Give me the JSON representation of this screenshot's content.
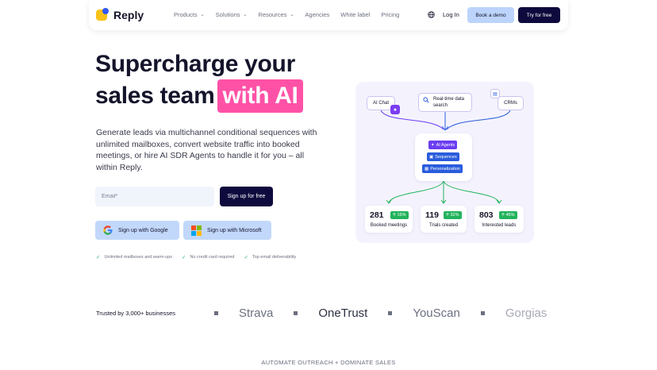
{
  "nav": {
    "brand": "Reply",
    "links": [
      {
        "label": "Products",
        "dropdown": true
      },
      {
        "label": "Solutions",
        "dropdown": true
      },
      {
        "label": "Resources",
        "dropdown": true
      },
      {
        "label": "Agencies",
        "dropdown": false
      },
      {
        "label": "White label",
        "dropdown": false
      },
      {
        "label": "Pricing",
        "dropdown": false
      }
    ],
    "login": "Log In",
    "book_demo": "Book a demo",
    "try_free": "Try for free",
    "language_icon": "globe-icon"
  },
  "hero": {
    "title_line1": "Supercharge your",
    "title_line2": "sales team",
    "title_highlight": "with AI",
    "subtitle": "Generate leads via multichannel conditional sequences with unlimited mailboxes, convert website traffic into booked meetings, or hire AI SDR Agents to handle it for you – all within Reply.",
    "email_placeholder": "Email*",
    "signup_button": "Sign up for free",
    "google_button": "Sign up with Google",
    "microsoft_button": "Sign up with Microsoft",
    "checks": [
      "Unlimited mailboxes and warm-ups",
      "No credit card required",
      "Top email deliverability"
    ]
  },
  "illustration": {
    "sources": [
      "AI Chat",
      "Real-time data search",
      "CRMs"
    ],
    "tags": [
      "AI Agents",
      "Sequences",
      "Personalization"
    ],
    "stats": [
      {
        "value": "281",
        "change": "15%",
        "label": "Booked meetings"
      },
      {
        "value": "119",
        "change": "32%",
        "label": "Trials created"
      },
      {
        "value": "803",
        "change": "45%",
        "label": "Interested leads"
      }
    ],
    "colors": {
      "accent_pink": "#ff52a7",
      "navy": "#0f0a3d",
      "purple": "#6b3df2",
      "blue": "#2a5cdc",
      "green": "#22b35c"
    }
  },
  "trusted": {
    "label": "Trusted by 3,000+ businesses",
    "logos": [
      "Strava",
      "OneTrust",
      "YouScan",
      "Gorgias"
    ]
  },
  "section": {
    "eyebrow": "AUTOMATE OUTREACH + DOMINATE SALES"
  }
}
